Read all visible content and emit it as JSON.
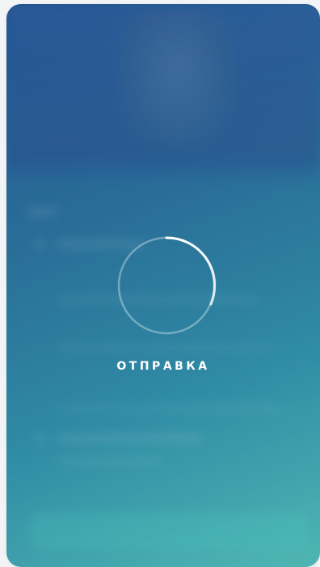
{
  "loader": {
    "status_text": "ОТПРАВКА",
    "spinner_icon": "progress-ring-icon"
  },
  "colors": {
    "gradient_start": "#22558f",
    "gradient_end": "#4fb6b3",
    "spinner_arc": "#ffffff",
    "status_text": "#ffffff"
  }
}
